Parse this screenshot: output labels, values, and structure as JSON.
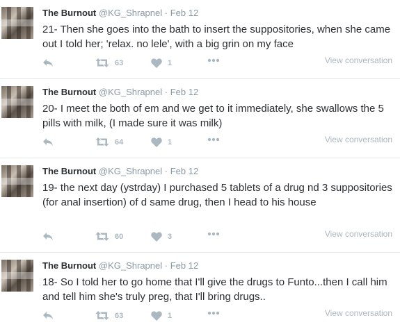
{
  "tweets": [
    {
      "name": "The Burnout",
      "handle": "@KG_Shrapnel",
      "separator": "·",
      "date": "Feb 12",
      "text": "21- Then she goes into the bath to insert the suppositories, when she came out I told her; 'relax. no lele', with a big grin on my face",
      "retweets": "63",
      "likes": "1",
      "view_conversation": "View conversation"
    },
    {
      "name": "The Burnout",
      "handle": "@KG_Shrapnel",
      "separator": "·",
      "date": "Feb 12",
      "text": "20- I meet the both of em  and we get to it immediately, she swallows the 5 pills with milk, (I made sure it was milk)",
      "retweets": "64",
      "likes": "1",
      "view_conversation": "View conversation"
    },
    {
      "name": "The Burnout",
      "handle": "@KG_Shrapnel",
      "separator": "·",
      "date": "Feb 12",
      "text": "19-  the next day (ystrday) I purchased 5 tablets of a drug nd 3 suppositories (for anal insertion) of d same drug, then I head to his house",
      "retweets": "60",
      "likes": "3",
      "view_conversation": "View conversation"
    },
    {
      "name": "The Burnout",
      "handle": "@KG_Shrapnel",
      "separator": "·",
      "date": "Feb 12",
      "text": "18- So I told her to go home that I'll give the drugs to Funto...then I call him and tell him she's truly preg, that I'll bring drugs..",
      "retweets": "63",
      "likes": "1",
      "view_conversation": "View conversation"
    }
  ],
  "icons": {
    "reply": "reply-icon",
    "retweet": "retweet-icon",
    "like": "heart-icon",
    "more": "more-dots-icon"
  },
  "colors": {
    "text": "#292f33",
    "muted": "#8899a6",
    "action": "#aab8c2",
    "divider": "#e1e8ed"
  }
}
